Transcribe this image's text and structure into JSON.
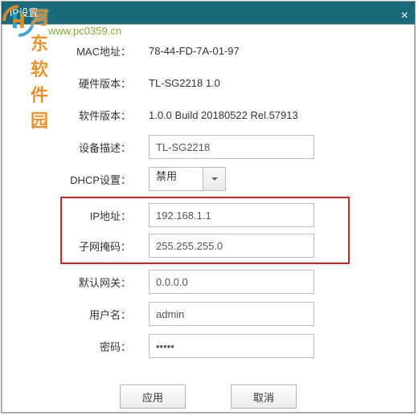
{
  "window": {
    "title": "IP设置",
    "close": "×"
  },
  "labels": {
    "mac": "MAC地址",
    "hw": "硬件版本",
    "sw": "软件版本",
    "desc": "设备描述",
    "dhcp": "DHCP设置",
    "ip": "IP地址",
    "mask": "子网掩码",
    "gw": "默认网关",
    "user": "用户名",
    "pwd": "密码",
    "colon": "："
  },
  "values": {
    "mac": "78-44-FD-7A-01-97",
    "hw": "TL-SG2218 1.0",
    "sw": "1.0.0 Build 20180522 Rel.57913",
    "desc": "TL-SG2218",
    "dhcp_selected": "禁用",
    "ip": "192.168.1.1",
    "mask": "255.255.255.0",
    "gw": "0.0.0.0",
    "user": "admin",
    "pwd": "•••••"
  },
  "buttons": {
    "apply": "应用",
    "cancel": "取消"
  },
  "watermark": {
    "line1": "河东软件园",
    "line2": "www.pc0359.cn"
  }
}
